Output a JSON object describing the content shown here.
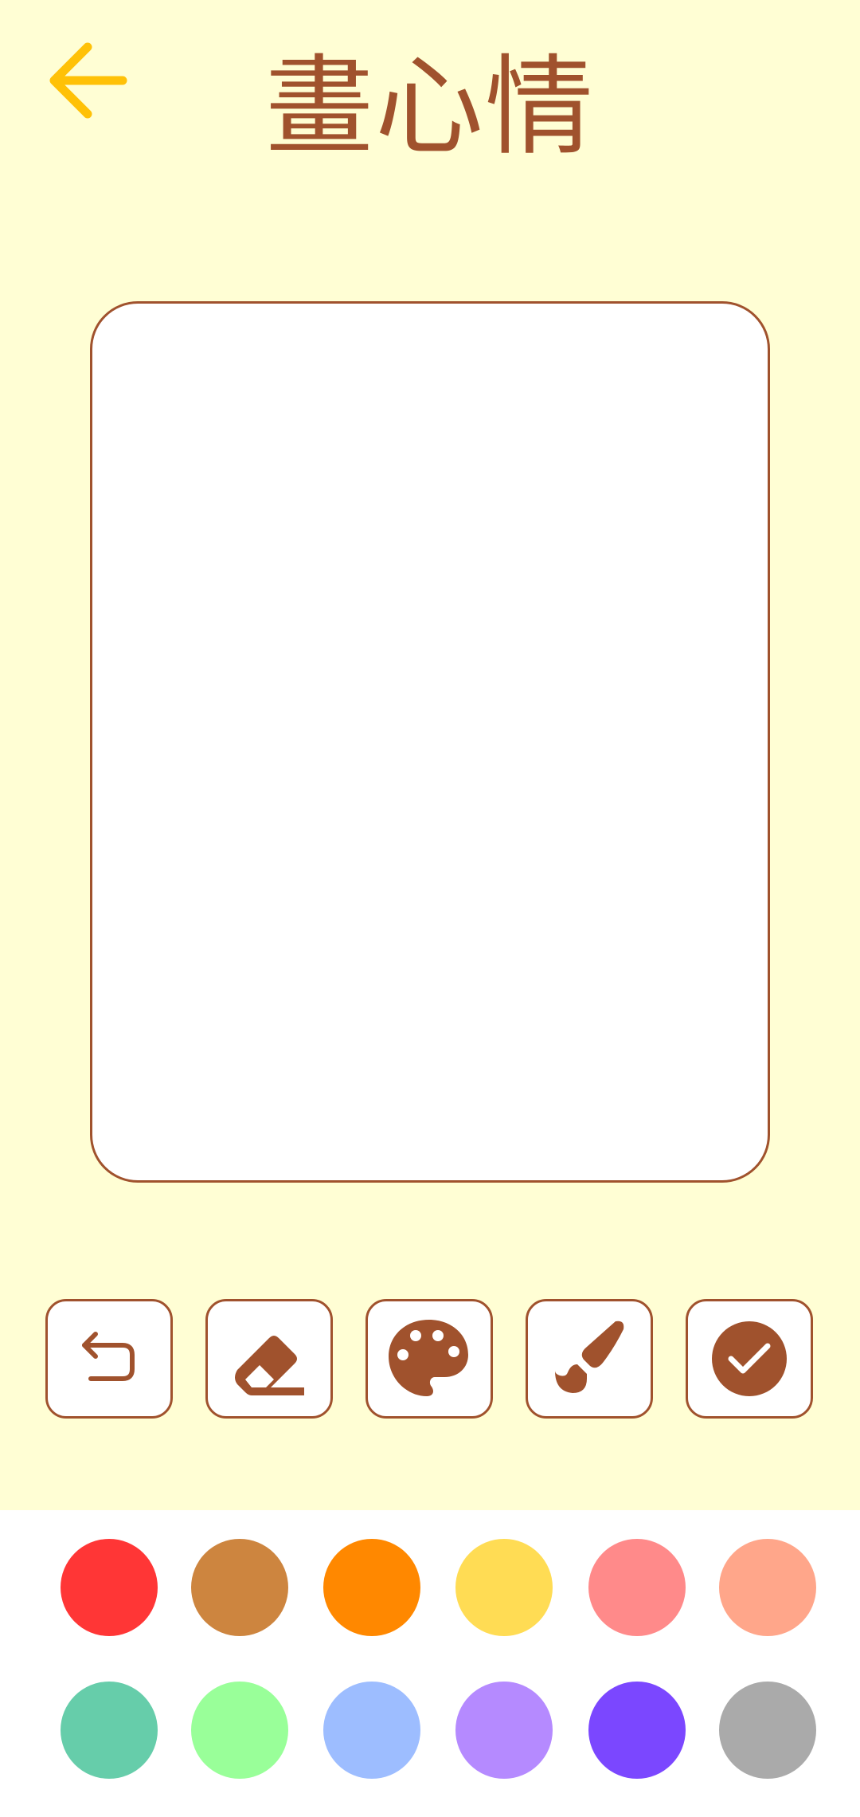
{
  "header": {
    "title": "畫心情",
    "back_icon": "arrow-left-icon",
    "back_color": "#FFC107"
  },
  "theme": {
    "background": "#FFFED4",
    "accent": "#A0522D",
    "canvas_background": "#FFFFFF"
  },
  "tools": [
    {
      "name": "undo",
      "icon": "undo-icon"
    },
    {
      "name": "eraser",
      "icon": "eraser-icon"
    },
    {
      "name": "palette",
      "icon": "palette-icon"
    },
    {
      "name": "brush",
      "icon": "brush-icon"
    },
    {
      "name": "done",
      "icon": "check-circle-icon"
    }
  ],
  "colors": [
    "#FF3636",
    "#CD853F",
    "#FF8800",
    "#FFDC54",
    "#FF8A8A",
    "#FFA68A",
    "#66CDAA",
    "#99FF99",
    "#9DBDFF",
    "#B58AFF",
    "#7B47FF",
    "#AAAAAA"
  ]
}
